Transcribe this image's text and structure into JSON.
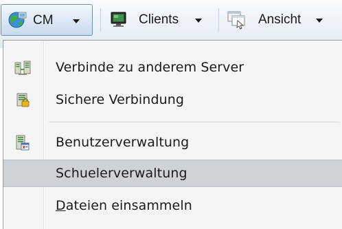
{
  "toolbar": {
    "items": [
      {
        "label": "CM",
        "icon": "network-globe-icon"
      },
      {
        "label": "Clients",
        "icon": "monitor-icon"
      },
      {
        "label": "Ansicht",
        "icon": "view-icon"
      }
    ]
  },
  "menu": {
    "items": [
      {
        "label": "Verbinde zu anderem Server",
        "icon": "server-connect-icon"
      },
      {
        "label": "Sichere Verbindung",
        "icon": "secure-connection-icon"
      },
      {
        "label": "Benutzerverwaltung",
        "icon": "user-management-icon"
      },
      {
        "label": "Schuelerverwaltung",
        "icon": "",
        "state": "highlighted"
      },
      {
        "label_underlined": "D",
        "label_rest": "ateien einsammeln",
        "icon": ""
      }
    ]
  },
  "colors": {
    "menu_background": "#f5f5f5",
    "highlight": "#cfd3d8",
    "toolbar_active_border": "#6e8bab"
  }
}
